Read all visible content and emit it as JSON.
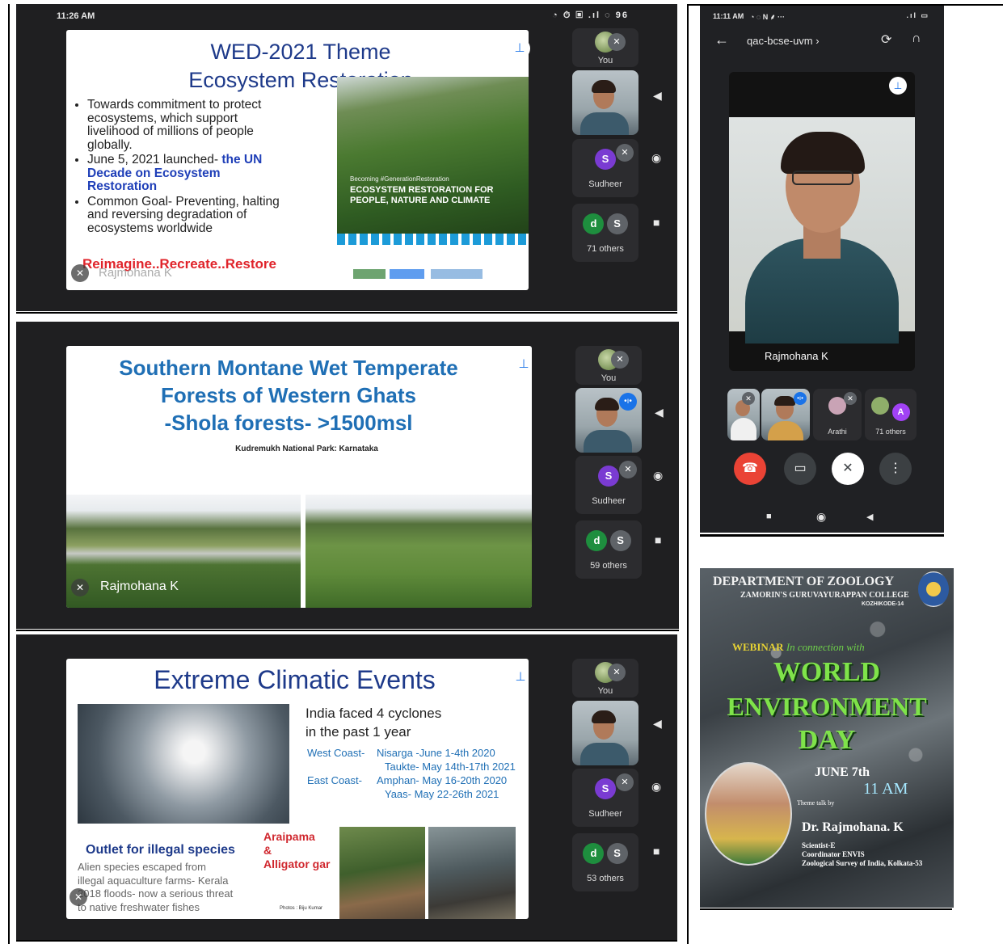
{
  "panel1": {
    "status_time": "11:26 AM",
    "status_right": "◔ ⏱ ▣ .ıl ◌ 96",
    "slide": {
      "title_line1": "WED-2021 Theme",
      "title_line2": "Ecosystem Restoration",
      "bullet1": "Towards commitment to protect ecosystems, which support livelihood of millions of people globally.",
      "bullet2_prefix": "June 5, 2021 launched- ",
      "bullet2_blue": "the UN Decade on Ecosystem Restoration",
      "bullet3": "Common Goal- Preventing, halting and reversing degradation of ecosystems worldwide",
      "image_caption_small": "Becoming #GenerationRestoration",
      "image_caption": "ECOSYSTEM RESTORATION FOR PEOPLE, NATURE AND CLIMATE",
      "footer_red": "Reimagine..Recreate..Restore",
      "presenter": "Rajmohana K"
    },
    "participants": {
      "you": "You",
      "sudheer_initial": "S",
      "sudheer": "Sudheer",
      "d": "d",
      "s": "S",
      "others": "71 others"
    }
  },
  "panel2": {
    "slide": {
      "title_line1": "Southern Montane Wet Temperate",
      "title_line2": "Forests of Western Ghats",
      "title_line3": "-Shola forests- >1500msl",
      "subtitle": "Kudremukh National Park: Karnataka",
      "presenter": "Rajmohana K"
    },
    "participants": {
      "you": "You",
      "sudheer_initial": "S",
      "sudheer": "Sudheer",
      "d": "d",
      "s": "S",
      "others": "59 others"
    }
  },
  "panel3": {
    "slide": {
      "title": "Extreme Climatic Events",
      "intro_line1": "India faced 4 cyclones",
      "intro_line2": "in the past 1 year",
      "west_label": "West Coast-",
      "west_1": "Nisarga -June 1-4th 2020",
      "west_2": "Taukte- May 14th-17th 2021",
      "east_label": "East Coast-",
      "east_1": "Amphan- May 16-20th 2020",
      "east_2": "Yaas- May 22-26th 2021",
      "outlet_title": "Outlet for illegal species",
      "outlet_body1": "Alien species escaped from",
      "outlet_body2": "illegal aquaculture farms- Kerala",
      "outlet_body3": "2018 floods- now a serious threat",
      "outlet_body4": "to native freshwater fishes",
      "species_line1": "Araipama",
      "species_line2": "&",
      "species_line3": "Alligator gar",
      "photo_credit": "Photos : Biju Kumar"
    },
    "participants": {
      "you": "You",
      "sudheer_initial": "S",
      "sudheer": "Sudheer",
      "d": "d",
      "s": "S",
      "others": "53 others"
    }
  },
  "panel4": {
    "status_time": "11:11 AM",
    "status_right": ".ıl ▭",
    "meeting_code": "qac-bcse-uvm ›",
    "speaker_name": "Rajmohana K",
    "strip": {
      "arathi": "Arathi",
      "a": "A",
      "others": "71 others"
    }
  },
  "poster": {
    "dept": "DEPARTMENT OF ZOOLOGY",
    "college": "ZAMORIN'S GURUVAYURAPPAN COLLEGE",
    "city": "KOZHIKODE-14",
    "webinar": "WEBINAR",
    "webinar_sub": "In connection with",
    "world": "WORLD",
    "environment": "ENVIRONMENT",
    "day": "DAY",
    "date": "JUNE 7th",
    "time": "11 AM",
    "theme_by": "Theme talk by",
    "speaker": "Dr. Rajmohana. K",
    "role1": "Scientist-E",
    "role2": "Coordinator ENVIS",
    "role3": "Zoological Survey of India, Kolkata-53"
  }
}
